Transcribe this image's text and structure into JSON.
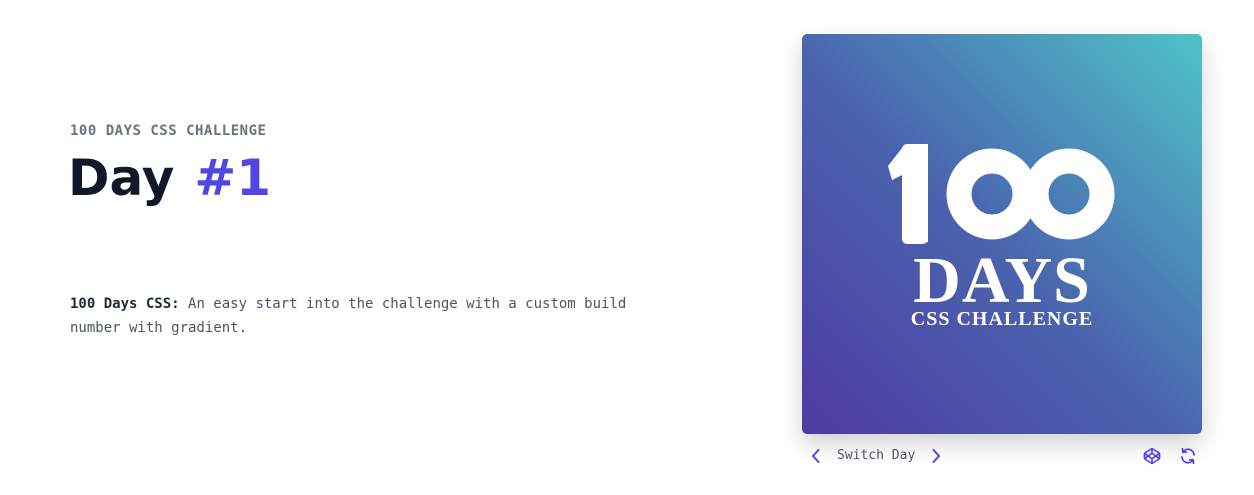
{
  "header": {
    "kicker": "100 DAYS CSS CHALLENGE",
    "day_word": "Day",
    "day_number": "#1"
  },
  "description": {
    "lead": "100 Days CSS:",
    "body": "An easy start into the challenge with a custom build number with gradient."
  },
  "preview": {
    "logo_number": "100",
    "logo_days": "DAYS",
    "logo_subtitle": "CSS CHALLENGE",
    "gradient": [
      "#4e3aa3",
      "#4a64ae",
      "#4ec4c8"
    ]
  },
  "controls": {
    "switch_label": "Switch Day",
    "icons": {
      "prev": "chevron-left-icon",
      "next": "chevron-right-icon",
      "codepen": "codepen-icon",
      "refresh": "refresh-icon"
    },
    "accent": "#4f46e5"
  }
}
